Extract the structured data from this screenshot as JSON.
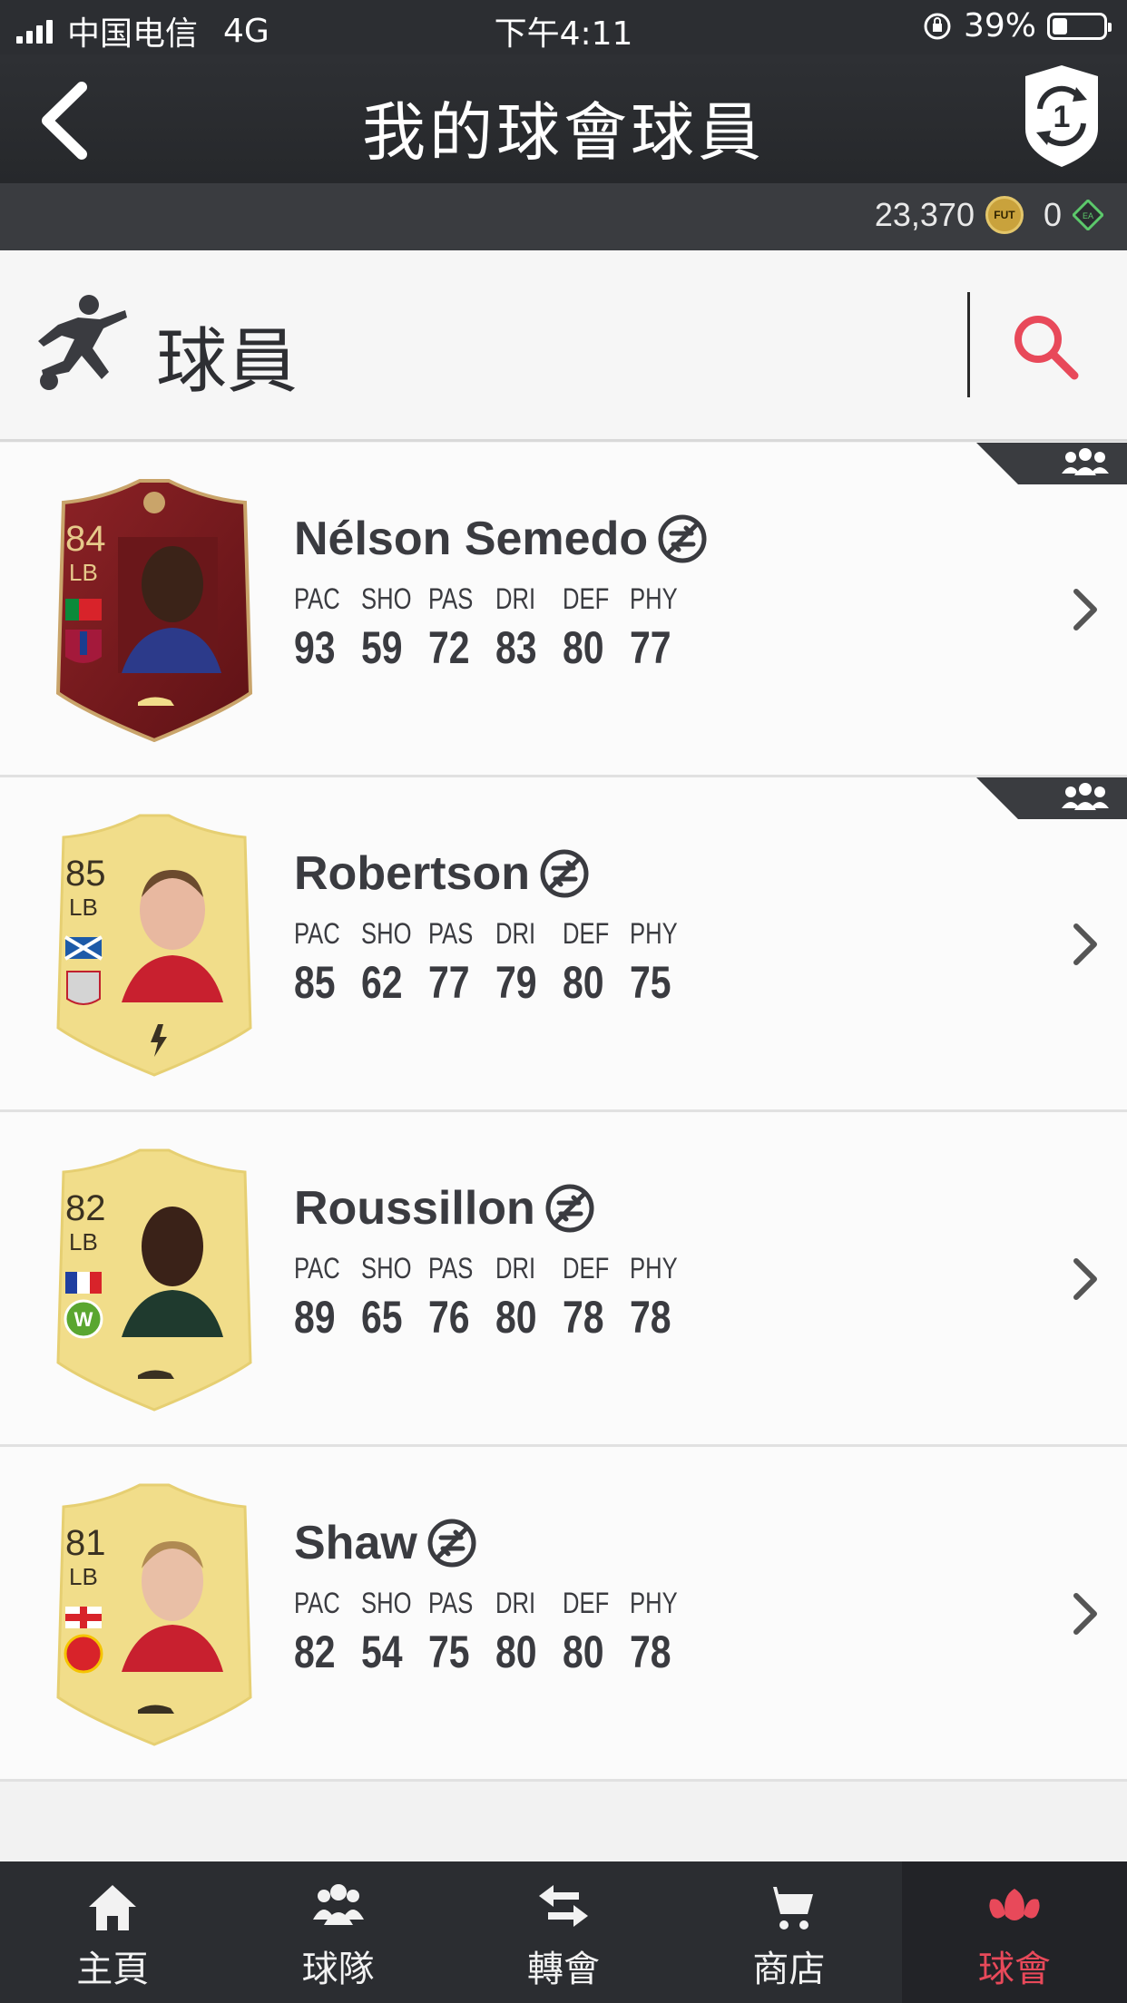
{
  "status_bar": {
    "carrier": "中国电信",
    "network": "4G",
    "time": "下午4:11",
    "battery": "39%"
  },
  "header": {
    "title": "我的球會球員",
    "badge_number": "1"
  },
  "currency": {
    "coins": "23,370",
    "coin_label": "FUT",
    "points": "0"
  },
  "section": {
    "label": "球員"
  },
  "stat_labels": [
    "PAC",
    "SHO",
    "PAS",
    "DRI",
    "DEF",
    "PHY"
  ],
  "players": [
    {
      "name": "Nélson Semedo",
      "rating": "84",
      "position": "LB",
      "card": "red",
      "stats": [
        "93",
        "59",
        "72",
        "83",
        "80",
        "77"
      ],
      "corner_tag": true
    },
    {
      "name": "Robertson",
      "rating": "85",
      "position": "LB",
      "card": "gold",
      "stats": [
        "85",
        "62",
        "77",
        "79",
        "80",
        "75"
      ],
      "corner_tag": true
    },
    {
      "name": "Roussillon",
      "rating": "82",
      "position": "LB",
      "card": "gold",
      "stats": [
        "89",
        "65",
        "76",
        "80",
        "78",
        "78"
      ],
      "corner_tag": false
    },
    {
      "name": "Shaw",
      "rating": "81",
      "position": "LB",
      "card": "gold",
      "stats": [
        "82",
        "54",
        "75",
        "80",
        "80",
        "78"
      ],
      "corner_tag": false
    }
  ],
  "bottom_nav": [
    {
      "label": "主頁",
      "icon": "home-icon"
    },
    {
      "label": "球隊",
      "icon": "team-icon"
    },
    {
      "label": "轉會",
      "icon": "transfer-icon"
    },
    {
      "label": "商店",
      "icon": "cart-icon"
    },
    {
      "label": "球會",
      "icon": "club-icon",
      "active": true
    }
  ],
  "colors": {
    "accent": "#e8495a",
    "header": "#2c2e32",
    "gold_card": "#f1dd8a",
    "red_card": "#7a1a1c"
  }
}
